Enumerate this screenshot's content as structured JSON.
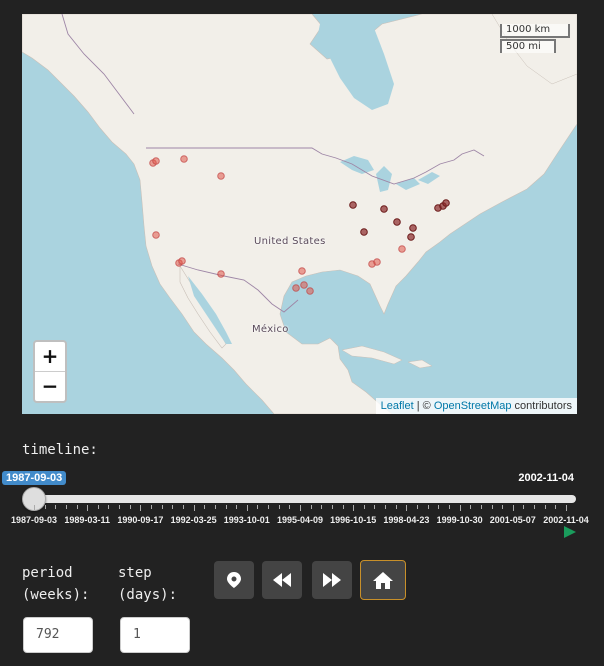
{
  "map": {
    "labels": {
      "us": "United States",
      "mexico": "México"
    },
    "zoom": {
      "in": "+",
      "out": "−"
    },
    "scale": {
      "km": "1000 km",
      "mi": "500 mi"
    },
    "attribution": {
      "leaflet": "Leaflet",
      "sep": " | © ",
      "osm": "OpenStreetMap",
      "suffix": " contributors"
    },
    "colors": {
      "water": "#aad3df",
      "land": "#f2efe9",
      "marker_fill": "#e0584a",
      "marker_dark": "#8b2a2a"
    }
  },
  "timeline": {
    "label": "timeline:",
    "from": "1987-09-03",
    "to": "2002-11-04",
    "ticks": [
      "1987-09-03",
      "1989-03-11",
      "1990-09-17",
      "1992-03-25",
      "1993-10-01",
      "1995-04-09",
      "1996-10-15",
      "1998-04-23",
      "1999-10-30",
      "2001-05-07",
      "2002-11-04"
    ]
  },
  "controls": {
    "period_label_1": "period",
    "period_label_2": "(weeks):",
    "period_value": "792",
    "step_label_1": "step",
    "step_label_2": "(days):",
    "step_value": "1",
    "buttons": [
      "map-marker-icon",
      "rewind-icon",
      "fast-forward-icon",
      "home-icon"
    ]
  }
}
